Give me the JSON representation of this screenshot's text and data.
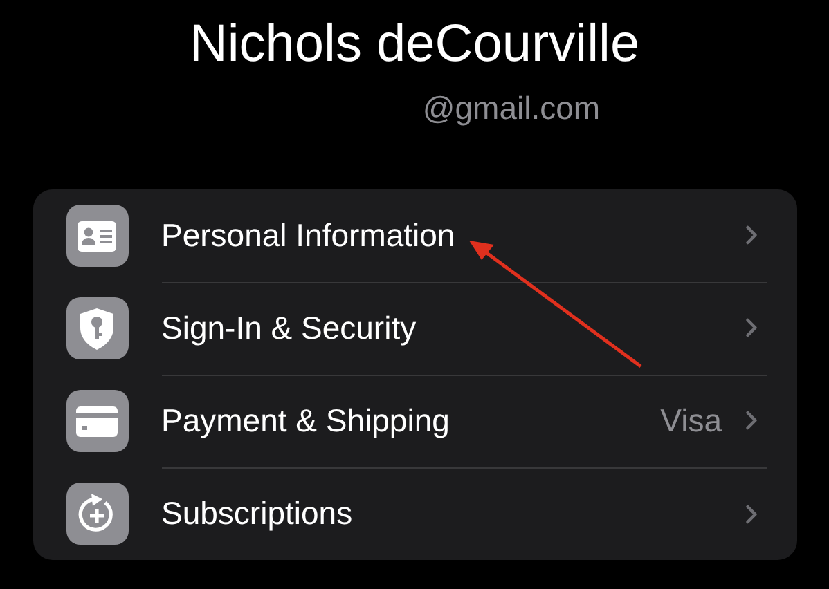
{
  "profile": {
    "name": "Nichols deCourville",
    "email": "@gmail.com"
  },
  "rows": [
    {
      "kind": "id-card",
      "label": "Personal Information"
    },
    {
      "kind": "shield-key",
      "label": "Sign-In & Security"
    },
    {
      "kind": "card",
      "label": "Payment & Shipping",
      "value": "Visa"
    },
    {
      "kind": "subscription",
      "label": "Subscriptions"
    }
  ]
}
